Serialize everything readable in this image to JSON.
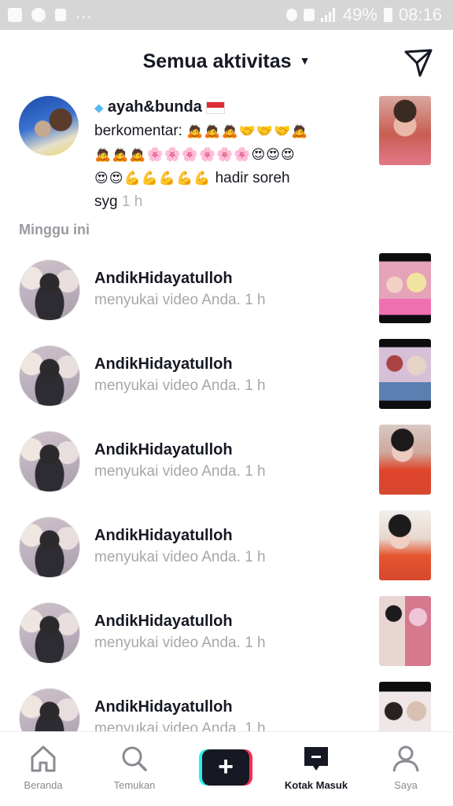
{
  "status_bar": {
    "left_icons": [
      "gallery-icon",
      "chat-bubble-icon",
      "tiktok-icon"
    ],
    "dots": "...",
    "battery_percent": "49%",
    "time": "08:16"
  },
  "header": {
    "title": "Semua aktivitas",
    "caret": "▼",
    "direct_message_icon": "send-icon"
  },
  "featured": {
    "username": "ayah&bunda",
    "line_text": "berkomentar:",
    "emoji_line_1": "🙇🙇🙇🤝🤝🤝🙇",
    "emoji_line_2": "🙇🙇🙇🌸🌸🌸🌸🌸🌸😍😍😍",
    "emoji_line_3": "😍😍💪💪💪💪💪",
    "comment_end": "hadir soreh",
    "comment_last": "syg",
    "time": "1 h"
  },
  "section_label": "Minggu ini",
  "activities": [
    {
      "name": "AndikHidayatulloh",
      "action": "menyukai video Anda.",
      "time": "1 h"
    },
    {
      "name": "AndikHidayatulloh",
      "action": "menyukai video Anda.",
      "time": "1 h"
    },
    {
      "name": "AndikHidayatulloh",
      "action": "menyukai video Anda.",
      "time": "1 h"
    },
    {
      "name": "AndikHidayatulloh",
      "action": "menyukai video Anda.",
      "time": "1 h"
    },
    {
      "name": "AndikHidayatulloh",
      "action": "menyukai video Anda.",
      "time": "1 h"
    },
    {
      "name": "AndikHidayatulloh",
      "action": "menyukai video Anda.",
      "time": "1 h"
    }
  ],
  "nav": {
    "home": "Beranda",
    "discover": "Temukan",
    "add": "+",
    "inbox": "Kotak Masuk",
    "me": "Saya"
  },
  "colors": {
    "accent_red": "#fe2c55",
    "accent_cyan": "#26f4ee",
    "text_dark": "#161823",
    "text_muted": "#a6a7ab"
  }
}
